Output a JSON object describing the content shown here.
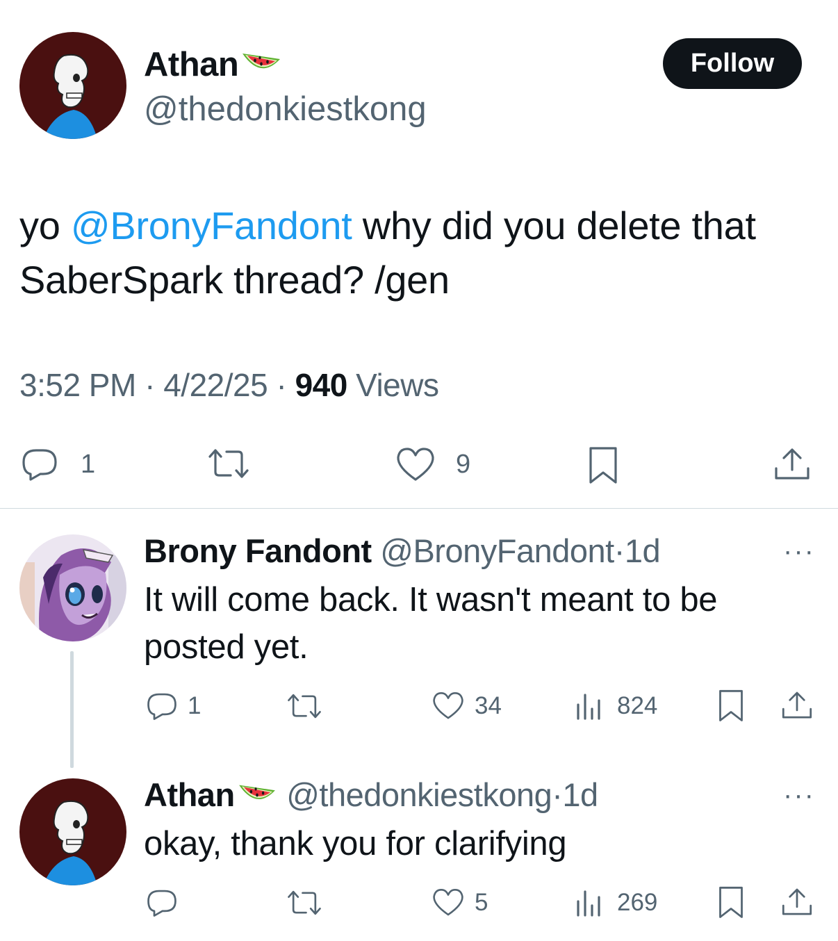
{
  "main_tweet": {
    "author_name": "Athan",
    "author_emoji": "watermelon-icon",
    "author_handle": "@thedonkiestkong",
    "follow_label": "Follow",
    "text_before": "yo ",
    "mention": "@BronyFandont",
    "text_after": " why did you delete that SaberSpark thread? /gen",
    "time": "3:52 PM",
    "date": "4/22/25",
    "views_count": "940",
    "views_label": "Views",
    "separator": "·",
    "reply_count": "1",
    "like_count": "9"
  },
  "replies": [
    {
      "author_name": "Brony Fandont",
      "author_handle": "@BronyFandont",
      "age": "1d",
      "separator": "·",
      "text": "It will come back. It wasn't meant to be posted yet.",
      "reply_count": "1",
      "like_count": "34",
      "view_count": "824",
      "more": "···"
    },
    {
      "author_name": "Athan",
      "author_emoji": "watermelon-icon",
      "author_handle": "@thedonkiestkong",
      "age": "1d",
      "separator": "·",
      "text": "okay, thank you for clarifying",
      "like_count": "5",
      "view_count": "269",
      "more": "···"
    }
  ],
  "colors": {
    "text": "#0f1419",
    "secondary": "#536471",
    "link": "#1d9bf0",
    "divider": "#cfd9de",
    "avatar_bg": "#4a1010"
  }
}
